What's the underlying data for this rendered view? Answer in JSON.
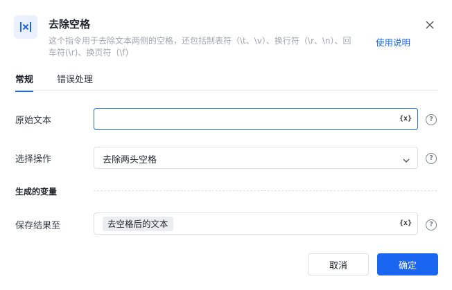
{
  "header": {
    "icon": "clear-space-icon",
    "title": "去除空格",
    "description": "这个指令用于去除文本两侧的空格，还包括制表符（\\t、\\v）、换行符（\\r、\\n）、回车符(\\r)、换页符（\\f)",
    "help_link": "使用说明",
    "close_icon": "close-icon"
  },
  "tabs": [
    {
      "label": "常规",
      "active": true
    },
    {
      "label": "错误处理",
      "active": false
    }
  ],
  "form": {
    "source_text": {
      "label": "原始文本",
      "value": "",
      "var_icon": "{x}",
      "help": "?"
    },
    "operation": {
      "label": "选择操作",
      "value": "去除两头空格",
      "help": "?"
    },
    "section_title": "生成的变量",
    "save_to": {
      "label": "保存结果至",
      "tag": "去空格后的文本",
      "var_icon": "{x}",
      "help": "?"
    }
  },
  "buttons": {
    "cancel": "取消",
    "ok": "确定"
  },
  "colors": {
    "accent": "#1a66f0",
    "text": "#1f2329",
    "muted": "#a3a6ad"
  }
}
